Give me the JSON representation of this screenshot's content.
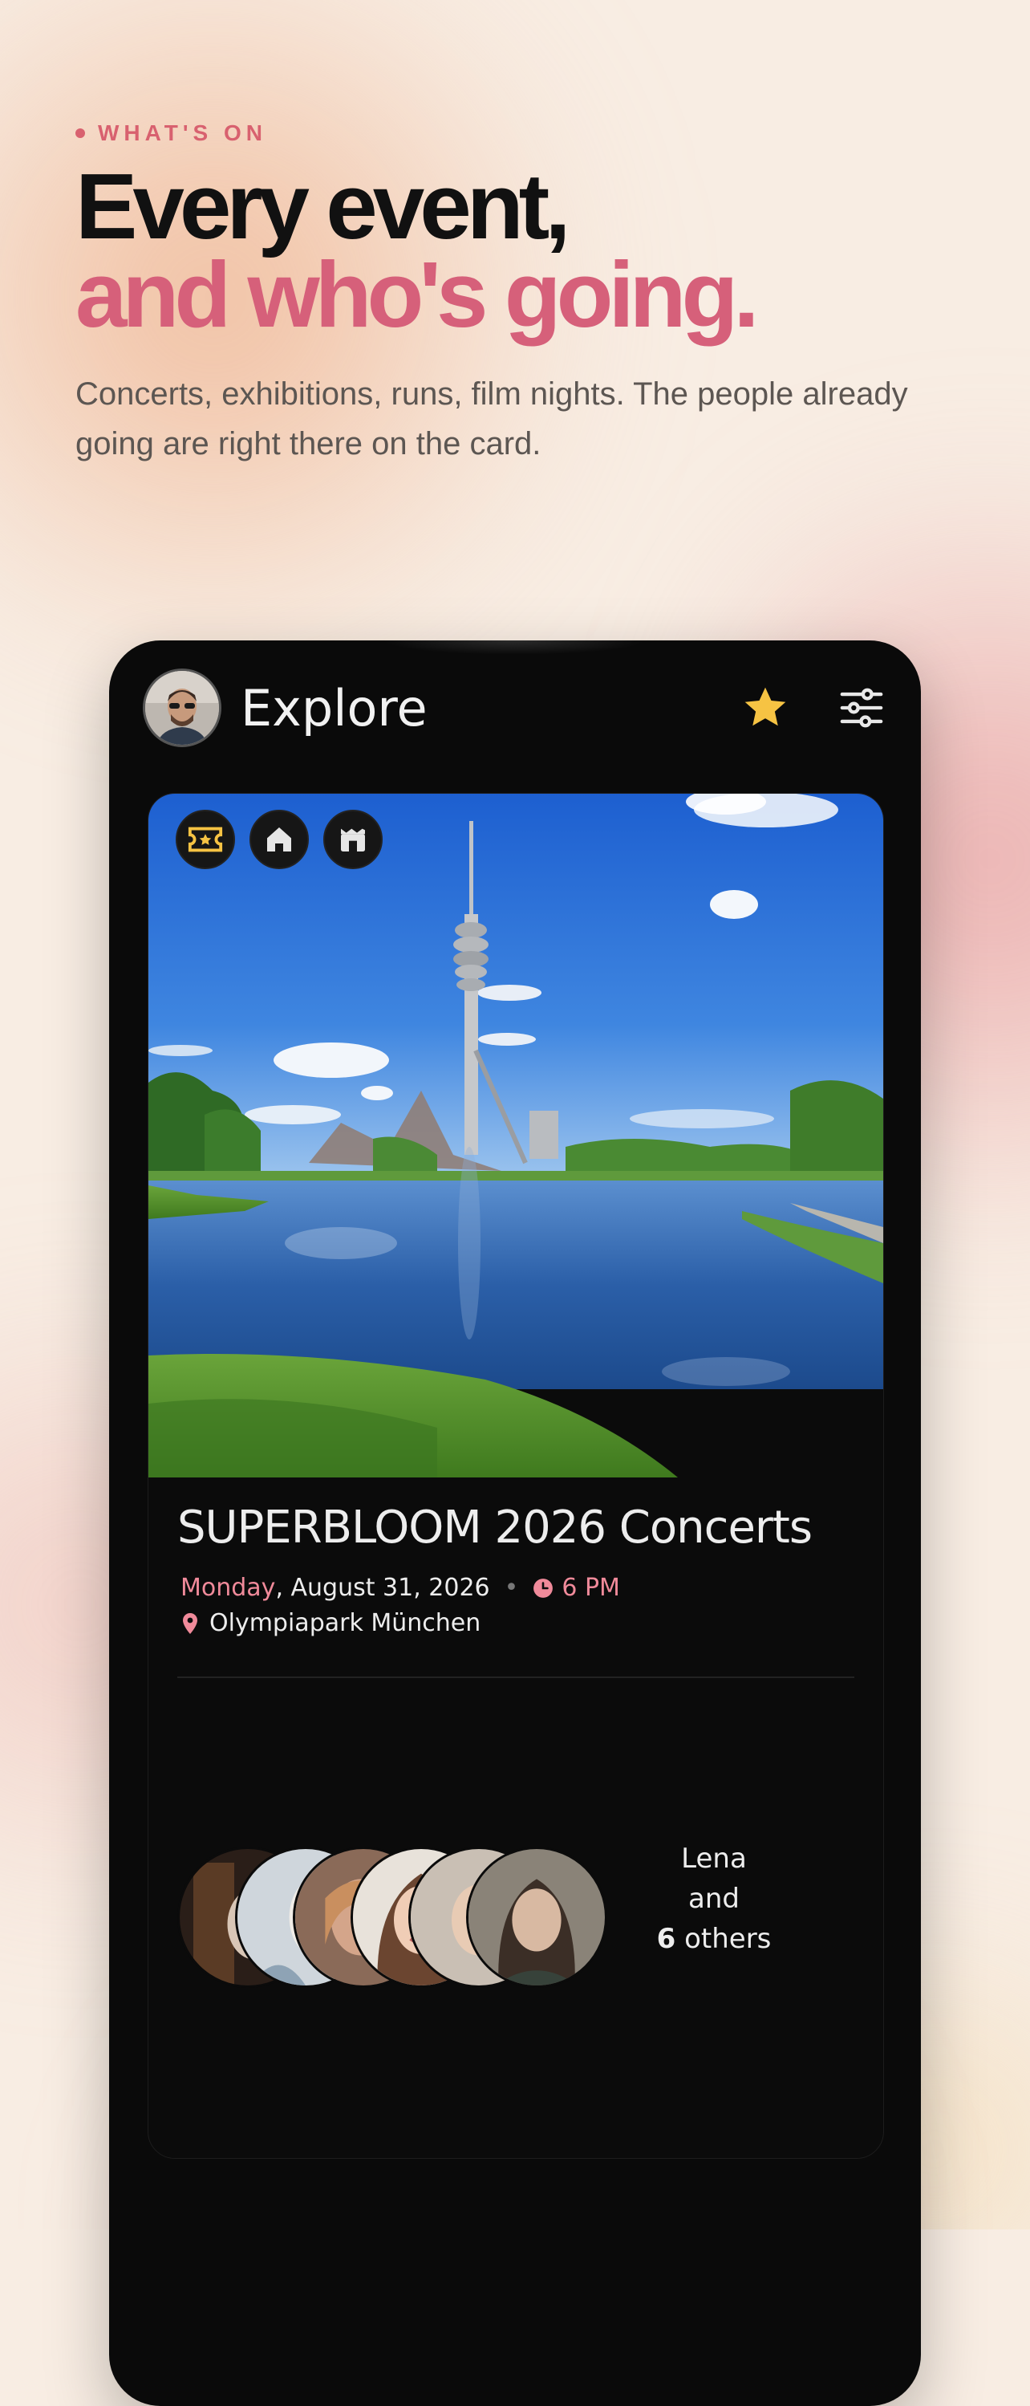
{
  "hero": {
    "eyebrow": "WHAT'S ON",
    "headline_line1": "Every event,",
    "headline_line2": "and who's going.",
    "subtitle": "Concerts, exhibitions, runs, film nights. The people already going are right there on the card."
  },
  "app": {
    "header_title": "Explore",
    "icons": [
      "avatar",
      "star-icon",
      "filter-sliders-icon"
    ]
  },
  "event": {
    "category_icons": [
      "ticket-icon",
      "venue-icon",
      "cinema-icon"
    ],
    "title": "SUPERBLOOM 2026 Concerts",
    "day": "Monday",
    "date": ", August 31, 2026",
    "separator": "•",
    "time": "6 PM",
    "location": "Olympiapark München",
    "going_name": "Lena",
    "going_and": "and",
    "going_count": "6",
    "going_others": " others"
  },
  "colors": {
    "accent_pink": "#d6607a",
    "accent_salmon": "#f08a9a",
    "star_yellow": "#f6c343",
    "background": "#f8ede3"
  }
}
